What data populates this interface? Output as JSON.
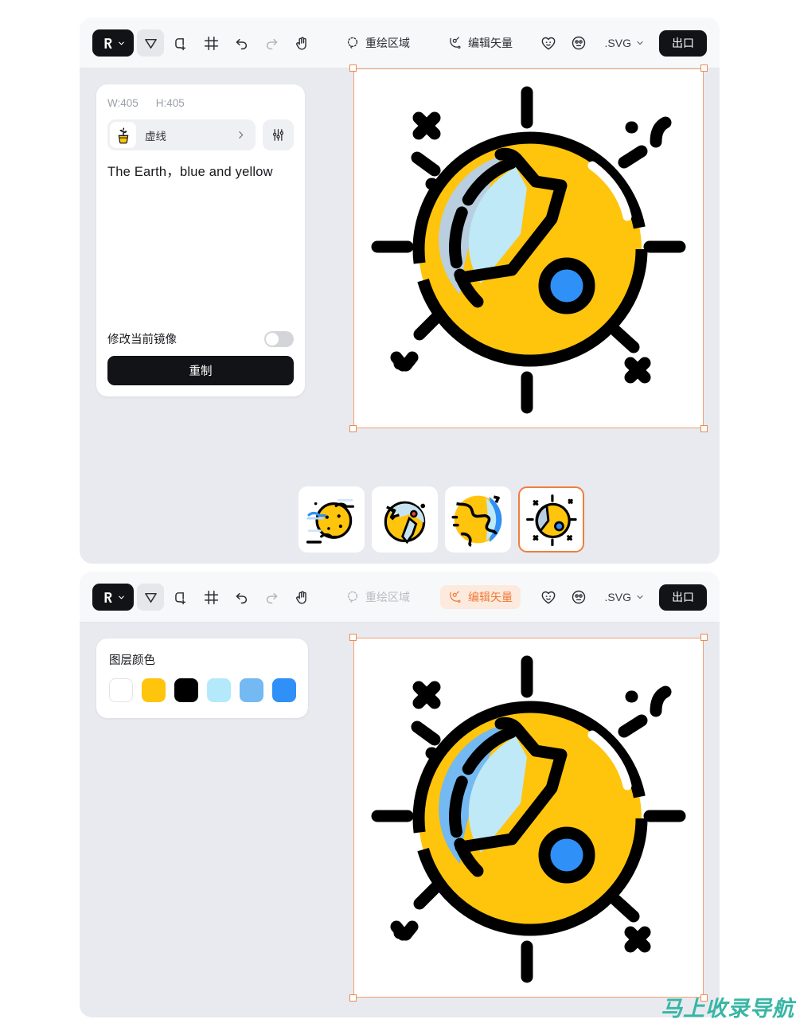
{
  "app": {
    "logo_icon": "app-logo-icon",
    "logo_caret": "chevron-down-icon"
  },
  "window_a": {
    "toolbar": {
      "tools": [
        {
          "name": "select-tool",
          "icon": "cursor-arrow-icon",
          "state": "active"
        },
        {
          "name": "add-shape-tool",
          "icon": "shape-plus-icon",
          "state": "normal"
        },
        {
          "name": "crop-tool",
          "icon": "crop-frame-icon",
          "state": "normal"
        },
        {
          "name": "undo-tool",
          "icon": "undo-arrow-icon",
          "state": "normal"
        },
        {
          "name": "redo-tool",
          "icon": "redo-arrow-icon",
          "state": "disabled"
        },
        {
          "name": "pan-tool",
          "icon": "hand-icon",
          "state": "normal"
        }
      ],
      "redraw_region": {
        "label": "重绘区域",
        "icon": "lasso-dashed-icon",
        "state": "normal"
      },
      "edit_vector": {
        "label": "编辑矢量",
        "icon": "vector-node-icon",
        "state": "normal"
      },
      "like_icon": "heart-smile-icon",
      "feedback_icon": "face-neutral-icon",
      "format": {
        "value": ".SVG",
        "caret": "chevron-down-icon"
      },
      "export_label": "出口"
    },
    "panel": {
      "width_label": "W:405",
      "height_label": "H:405",
      "preset": {
        "icon": "potted-plant-icon",
        "label": "虚线",
        "chevron": "chevron-right-icon"
      },
      "settings_icon": "sliders-icon",
      "prompt": "The Earth，blue and yellow",
      "toggle_label": "修改当前镜像",
      "toggle_on": false,
      "primary_button": "重制"
    },
    "thumbnails": [
      {
        "name": "thumbnail-planet-clouds",
        "selected": false
      },
      {
        "name": "thumbnail-earth-globe",
        "selected": false
      },
      {
        "name": "thumbnail-earth-map",
        "selected": false
      },
      {
        "name": "thumbnail-earth-rays",
        "selected": true
      }
    ]
  },
  "window_b": {
    "toolbar": {
      "tools": [
        {
          "name": "select-tool",
          "icon": "cursor-arrow-icon",
          "state": "active"
        },
        {
          "name": "add-shape-tool",
          "icon": "shape-plus-icon",
          "state": "normal"
        },
        {
          "name": "crop-tool",
          "icon": "crop-frame-icon",
          "state": "normal"
        },
        {
          "name": "undo-tool",
          "icon": "undo-arrow-icon",
          "state": "normal"
        },
        {
          "name": "redo-tool",
          "icon": "redo-arrow-icon",
          "state": "disabled"
        },
        {
          "name": "pan-tool",
          "icon": "hand-icon",
          "state": "normal"
        }
      ],
      "redraw_region": {
        "label": "重绘区域",
        "icon": "lasso-dashed-icon",
        "state": "disabled"
      },
      "edit_vector": {
        "label": "编辑矢量",
        "icon": "vector-node-icon",
        "state": "highlighted"
      },
      "like_icon": "heart-smile-icon",
      "feedback_icon": "face-neutral-icon",
      "format": {
        "value": ".SVG",
        "caret": "chevron-down-icon"
      },
      "export_label": "出口"
    },
    "panel": {
      "title": "图层颜色",
      "swatches": [
        {
          "name": "swatch-white",
          "hex": "#ffffff"
        },
        {
          "name": "swatch-yellow",
          "hex": "#ffc40c"
        },
        {
          "name": "swatch-black",
          "hex": "#000000"
        },
        {
          "name": "swatch-light-cyan",
          "hex": "#b3e9fb"
        },
        {
          "name": "swatch-sky-blue",
          "hex": "#74b9f2"
        },
        {
          "name": "swatch-blue",
          "hex": "#2f90f7"
        }
      ]
    }
  },
  "artwork": {
    "name": "earth-with-rays-illustration",
    "colors": {
      "yellow": "#ffc40c",
      "outline": "#000000",
      "continent_light": "#bfe9f7",
      "continent_shadow_a": "#b9cfe0",
      "continent_shadow_b": "#74b9f2",
      "dot_blue": "#2f90f7",
      "highlight": "#ffffff"
    }
  },
  "watermark": {
    "text": "马上收录导航",
    "hex": "#37b6a4"
  }
}
